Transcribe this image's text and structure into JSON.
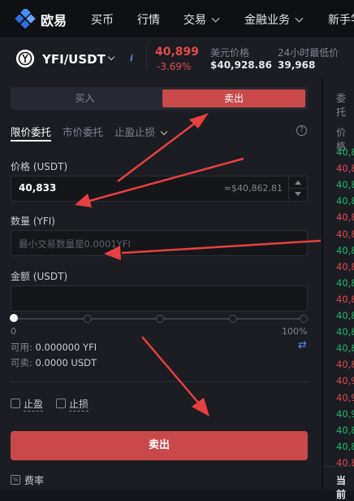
{
  "colors": {
    "accent_red": "#c9494b",
    "price_red": "#e0494b",
    "price_green": "#1fb86a",
    "link_blue": "#4a8ef5",
    "annotation_red": "#e8403f"
  },
  "nav": {
    "logo_text": "欧易",
    "logo_icon": "okx-logo-icon",
    "items": [
      {
        "label": "买币",
        "dropdown": false
      },
      {
        "label": "行情",
        "dropdown": false
      },
      {
        "label": "交易",
        "dropdown": true
      },
      {
        "label": "金融业务",
        "dropdown": true
      },
      {
        "label": "新手学",
        "dropdown": false
      }
    ]
  },
  "ticker": {
    "pair": "YFI/USDT",
    "last_price": "40,899",
    "change_pct": "-3.69%",
    "usd_price_label": "美元价格",
    "usd_price_value": "$40,928.86",
    "low_24h_label": "24小时最低价",
    "low_24h_value": "39,968"
  },
  "trade": {
    "buy_tab": "买入",
    "sell_tab": "卖出",
    "order_types": [
      "限价委托",
      "市价委托",
      "止盈止损"
    ],
    "price_label": "价格 (USDT)",
    "price_value": "40,833",
    "price_approx": "≈$40,862.81",
    "amount_label": "数量 (YFI)",
    "amount_placeholder": "最小交易数量是0.0001YFI",
    "total_label": "金额 (USDT)",
    "total_value": "",
    "slider_level_pct": 0,
    "slider_min_label": "0",
    "slider_max_label": "100%",
    "available_label": "可用:",
    "available_value": "0.000000 YFI",
    "sellable_label": "可卖:",
    "sellable_value": "0.0000 USDT",
    "take_profit_label": "止盈",
    "stop_loss_label": "止损",
    "submit_label": "卖出",
    "fee_label": "费率"
  },
  "orderbook_strip": {
    "tab_label": "委托",
    "price_header": "价格",
    "rows": [
      {
        "text": "40,8",
        "side": "buy"
      },
      {
        "text": "40,8",
        "side": "sell"
      },
      {
        "text": "40,8",
        "side": "buy"
      },
      {
        "text": "40,8",
        "side": "buy"
      },
      {
        "text": "40,8",
        "side": "sell"
      },
      {
        "text": "40,8",
        "side": "sell"
      },
      {
        "text": "40,8",
        "side": "buy"
      },
      {
        "text": "40,8",
        "side": "sell"
      },
      {
        "text": "40,8",
        "side": "buy"
      },
      {
        "text": "40,8",
        "side": "sell"
      },
      {
        "text": "40,8",
        "side": "buy"
      },
      {
        "text": "40,8",
        "side": "buy"
      },
      {
        "text": "40,8",
        "side": "buy"
      },
      {
        "text": "40,8",
        "side": "sell"
      },
      {
        "text": "40,9",
        "side": "sell"
      },
      {
        "text": "40,9",
        "side": "sell"
      },
      {
        "text": "40,9",
        "side": "buy"
      },
      {
        "text": "40,8",
        "side": "buy"
      },
      {
        "text": "40,8",
        "side": "buy"
      },
      {
        "text": "40,8",
        "side": "sell"
      }
    ],
    "bottom_label": "当前"
  }
}
